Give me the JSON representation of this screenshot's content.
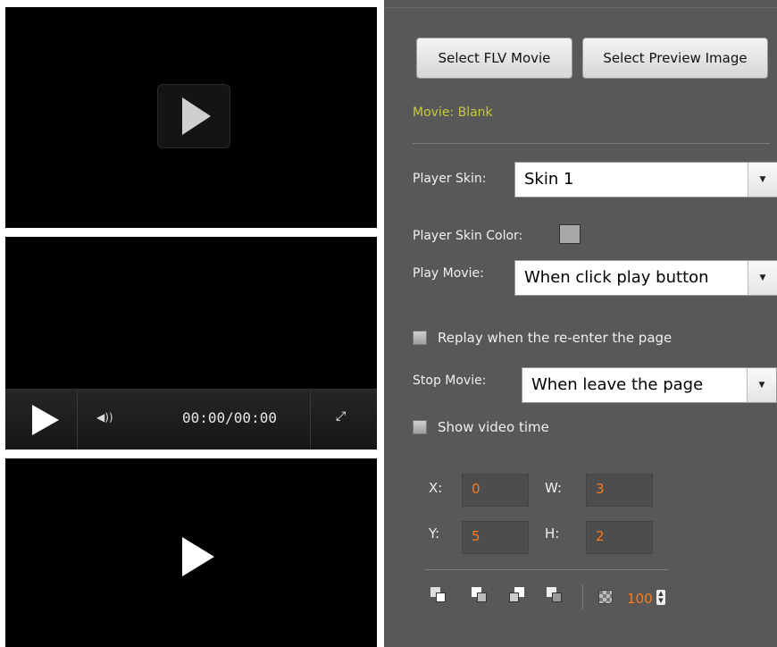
{
  "videos": {
    "v2": {
      "time": "00:00/00:00"
    }
  },
  "settings": {
    "select_flv_label": "Select FLV Movie",
    "select_preview_label": "Select Preview Image",
    "movie_status": "Movie: Blank",
    "player_skin_label": "Player Skin:",
    "player_skin_value": "Skin 1",
    "player_skin_color_label": "Player Skin Color:",
    "player_skin_color": "#a8a8a8",
    "play_movie_label": "Play Movie:",
    "play_movie_value": "When click play button",
    "replay_label": "Replay when the re-enter the page",
    "stop_movie_label": "Stop Movie:",
    "stop_movie_value": "When leave the page",
    "show_time_label": "Show video time"
  },
  "geometry": {
    "x_label": "X:",
    "x_value": "0",
    "w_label": "W:",
    "w_value": "3",
    "y_label": "Y:",
    "y_value": "5",
    "h_label": "H:",
    "h_value": "2"
  },
  "toolbar": {
    "opacity_value": "100",
    "icons": [
      "bring-to-front-icon",
      "bring-forward-icon",
      "send-backward-icon",
      "send-to-back-icon",
      "opacity-icon"
    ]
  },
  "colors": {
    "accent_orange": "#ff7a1a",
    "movie_status_color": "#c8c83c",
    "panel_bg": "#585858"
  }
}
